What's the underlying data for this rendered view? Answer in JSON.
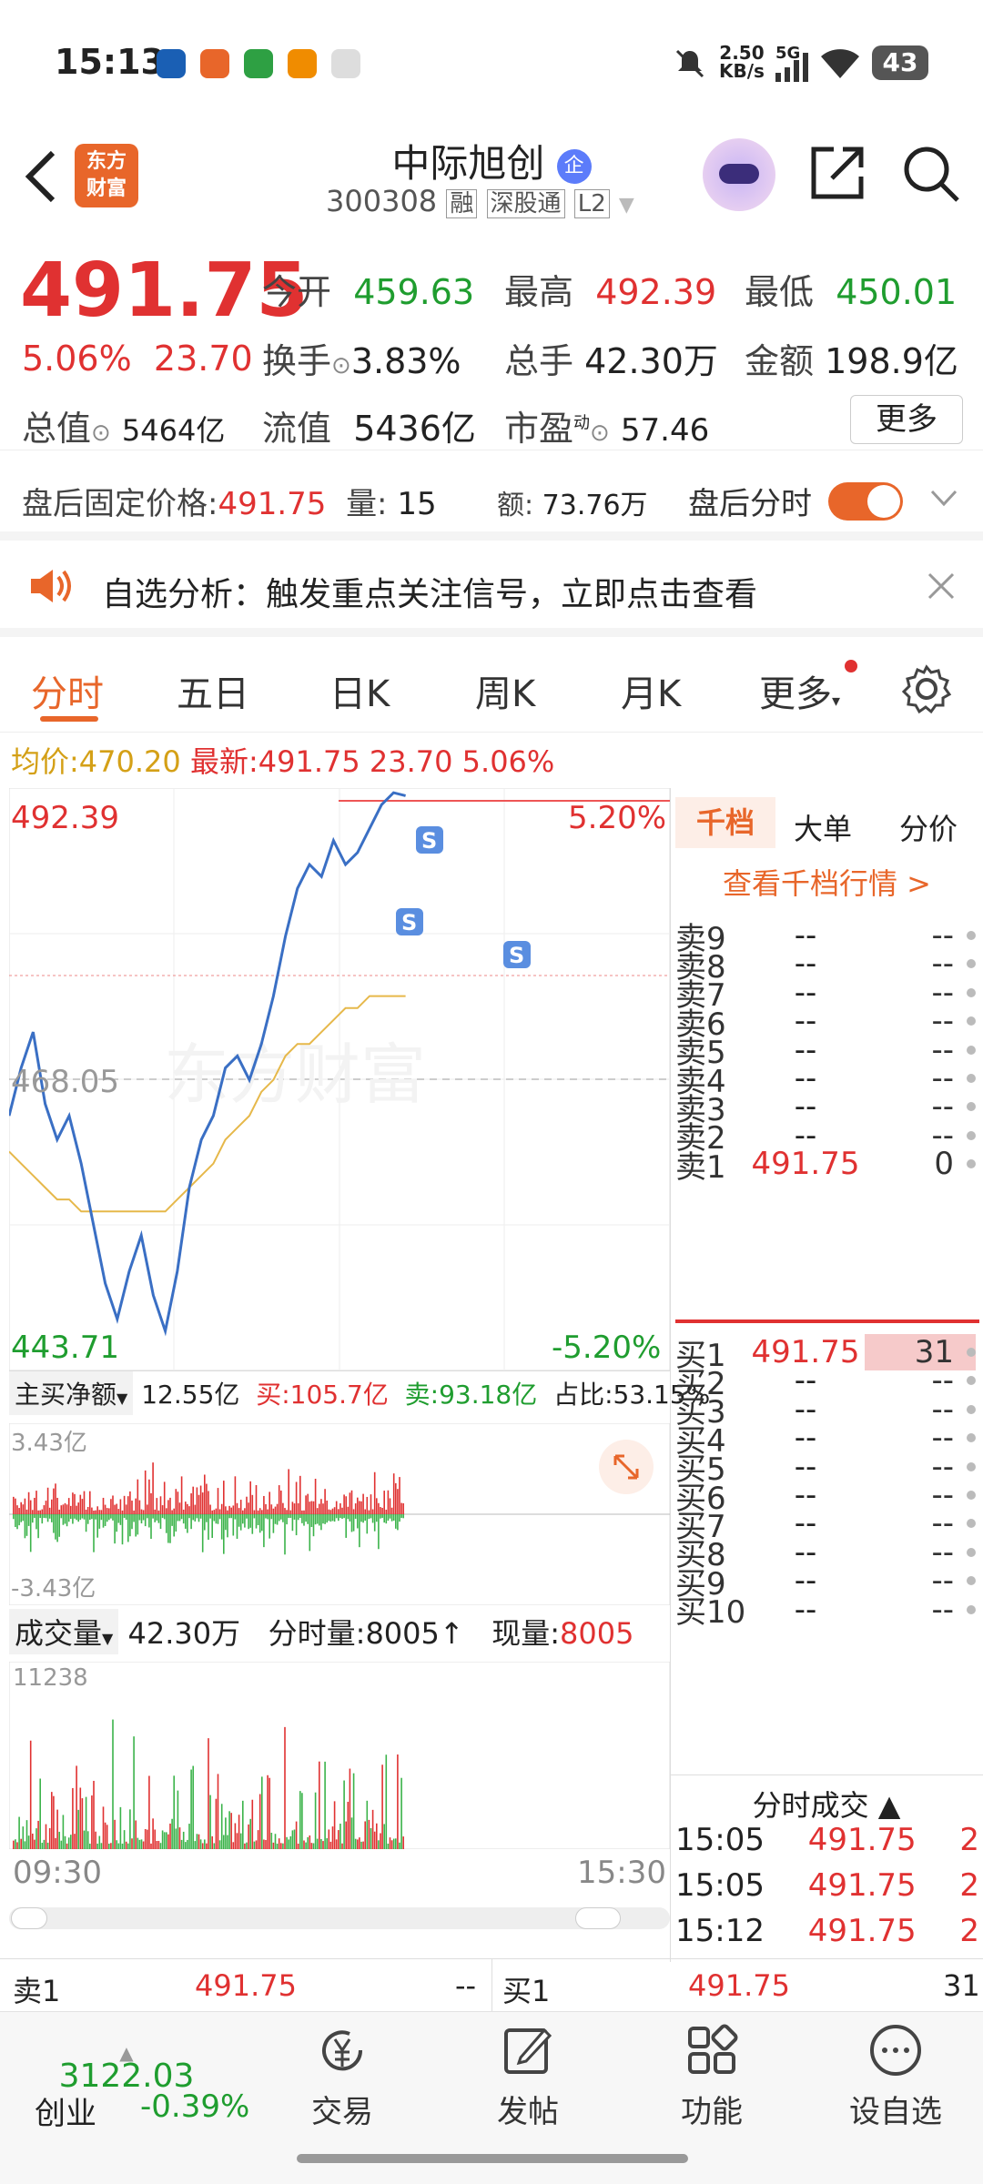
{
  "status_bar": {
    "time": "15:13",
    "net_speed": "2.50",
    "net_unit": "KB/s",
    "signal": "5G",
    "battery": "43"
  },
  "header": {
    "logo_text": [
      "东方",
      "财富"
    ],
    "stock_name": "中际旭创",
    "stock_badge": "企",
    "stock_code": "300308",
    "tags": [
      "融",
      "深股通",
      "L2"
    ]
  },
  "quote": {
    "price": "491.75",
    "change_pct": "5.06%",
    "change": "23.70",
    "open_label": "今开",
    "open": "459.63",
    "high_label": "最高",
    "high": "492.39",
    "low_label": "最低",
    "low": "450.01",
    "turnover_label": "换手",
    "turnover": "3.83%",
    "volume_label": "总手",
    "volume": "42.30万",
    "amount_label": "金额",
    "amount": "198.9亿",
    "mcap_label": "总值",
    "mcap": "5464亿",
    "float_label": "流值",
    "float": "5436亿",
    "pe_label": "市盈",
    "pe_sup": "动",
    "pe": "57.46",
    "more_label": "更多"
  },
  "after_hours": {
    "label": "盘后固定价格:",
    "price": "491.75",
    "vol_label": "量:",
    "vol": "15",
    "amt_label": "额:",
    "amt": "73.76万",
    "toggle_label": "盘后分时"
  },
  "notice": {
    "text": "自选分析：触发重点关注信号，立即点击查看"
  },
  "tabs": [
    "分时",
    "五日",
    "日K",
    "周K",
    "月K",
    "更多"
  ],
  "summary": {
    "avg_label": "均价:",
    "avg": "470.20",
    "latest_label": "最新:",
    "latest": "491.75",
    "chg": "23.70",
    "chg_pct": "5.06%"
  },
  "chart": {
    "y_high": "492.39",
    "y_mid": "468.05",
    "y_low": "443.71",
    "pct_high": "5.20%",
    "pct_low": "-5.20%",
    "watermark": "东方财富",
    "signal_marker": "S"
  },
  "chart_data": {
    "type": "line",
    "title": "",
    "x_start": "09:30",
    "x_end": "15:30",
    "ylim": [
      443.71,
      492.39
    ],
    "prev_close": 468.05,
    "series": [
      {
        "name": "",
        "values": [
          465,
          469,
          472,
          466,
          463,
          465,
          461,
          456,
          451,
          448,
          452,
          455,
          450,
          447,
          452,
          459,
          463,
          465,
          469,
          470,
          468,
          471,
          475,
          480,
          484,
          486,
          485,
          488,
          486,
          487,
          489,
          491,
          492,
          491.75
        ]
      },
      {
        "name": "均价",
        "values": [
          462,
          461,
          460,
          459,
          458,
          458,
          457,
          457,
          457,
          457,
          457,
          457,
          457,
          457,
          458,
          459,
          460,
          461,
          463,
          464,
          465,
          467,
          468,
          470,
          471,
          471,
          472,
          473,
          474,
          474,
          475,
          475,
          475,
          475
        ]
      }
    ]
  },
  "flow": {
    "label": "主买净额",
    "net": "12.55亿",
    "buy_label": "买:",
    "buy": "105.7亿",
    "sell_label": "卖:",
    "sell": "93.18亿",
    "ratio_label": "占比:",
    "ratio": "53.15%",
    "top": "3.43亿",
    "bottom": "-3.43亿"
  },
  "volume": {
    "label": "成交量",
    "total": "42.30万",
    "tick_label": "分时量:",
    "tick": "8005",
    "now_label": "现量:",
    "now": "8005",
    "max": "11238",
    "x_start": "09:30",
    "x_end": "15:30"
  },
  "orderbook": {
    "tabs": [
      "千档",
      "大单",
      "分价"
    ],
    "link": "查看千档行情 >",
    "asks": [
      {
        "name": "卖9",
        "price": "--",
        "vol": "--"
      },
      {
        "name": "卖8",
        "price": "--",
        "vol": "--"
      },
      {
        "name": "卖7",
        "price": "--",
        "vol": "--"
      },
      {
        "name": "卖6",
        "price": "--",
        "vol": "--"
      },
      {
        "name": "卖5",
        "price": "--",
        "vol": "--"
      },
      {
        "name": "卖4",
        "price": "--",
        "vol": "--"
      },
      {
        "name": "卖3",
        "price": "--",
        "vol": "--"
      },
      {
        "name": "卖2",
        "price": "--",
        "vol": "--"
      },
      {
        "name": "卖1",
        "price": "491.75",
        "vol": "0"
      }
    ],
    "bids": [
      {
        "name": "买1",
        "price": "491.75",
        "vol": "31"
      },
      {
        "name": "买2",
        "price": "--",
        "vol": "--"
      },
      {
        "name": "买3",
        "price": "--",
        "vol": "--"
      },
      {
        "name": "买4",
        "price": "--",
        "vol": "--"
      },
      {
        "name": "买5",
        "price": "--",
        "vol": "--"
      },
      {
        "name": "买6",
        "price": "--",
        "vol": "--"
      },
      {
        "name": "买7",
        "price": "--",
        "vol": "--"
      },
      {
        "name": "买8",
        "price": "--",
        "vol": "--"
      },
      {
        "name": "买9",
        "price": "--",
        "vol": "--"
      },
      {
        "name": "买10",
        "price": "--",
        "vol": "--"
      }
    ],
    "trades_title": "分时成交",
    "trades": [
      {
        "time": "15:05",
        "price": "491.75",
        "vol": "2"
      },
      {
        "time": "15:05",
        "price": "491.75",
        "vol": "2"
      },
      {
        "time": "15:12",
        "price": "491.75",
        "vol": "2"
      }
    ]
  },
  "bottom_quote": {
    "ask_label": "卖1",
    "ask_price": "491.75",
    "ask_vol": "--",
    "bid_label": "买1",
    "bid_price": "491.75",
    "bid_vol": "31"
  },
  "nav": {
    "index_value": "3122.03",
    "index_name": "创业",
    "index_chg": "-0.39%",
    "items": [
      "交易",
      "发帖",
      "功能",
      "设自选"
    ]
  },
  "colors": {
    "up": "#e03131",
    "down": "#1f9d2f",
    "accent": "#e8662a",
    "avg_line": "#e6b84a",
    "price_line": "#3a6fc4"
  }
}
